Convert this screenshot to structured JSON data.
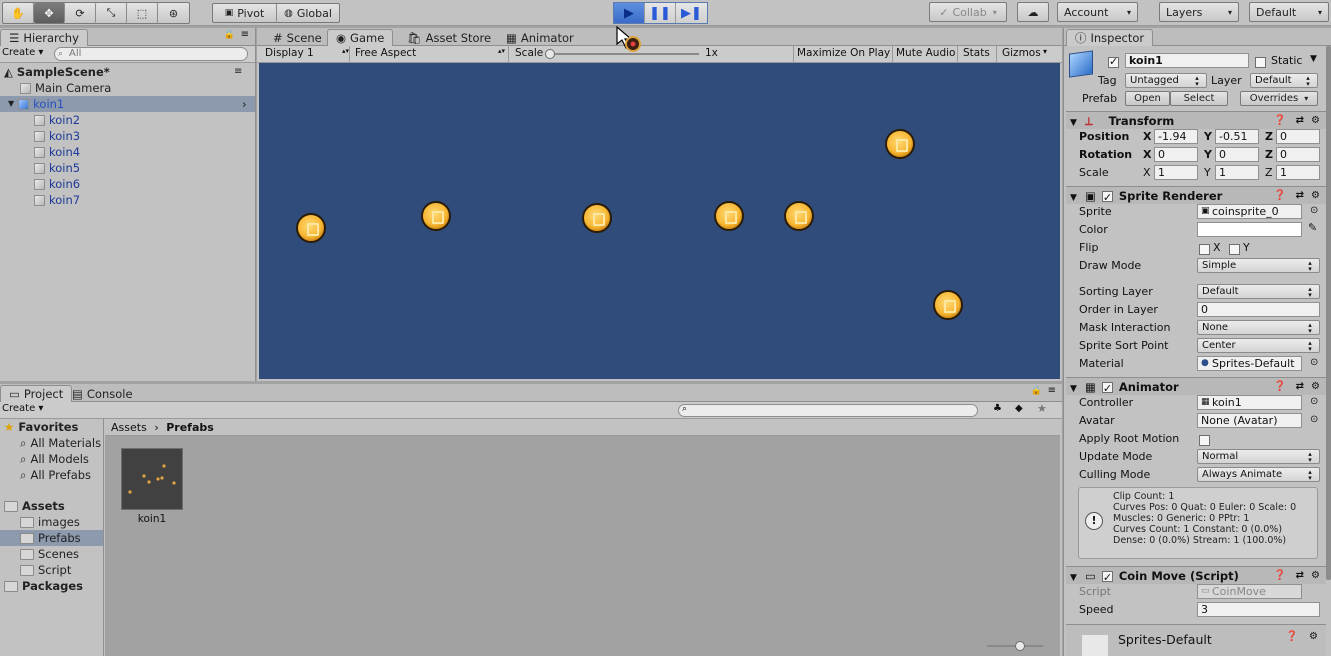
{
  "toolbar": {
    "pivot_label": "Pivot",
    "global_label": "Global",
    "collab_label": "Collab",
    "account_label": "Account",
    "layers_label": "Layers",
    "layout_label": "Default"
  },
  "hierarchy": {
    "tab": "Hierarchy",
    "create_label": "Create",
    "search_placeholder": "All",
    "scene_name": "SampleScene*",
    "items": [
      "Main Camera",
      "koin1",
      "koin2",
      "koin3",
      "koin4",
      "koin5",
      "koin6",
      "koin7"
    ]
  },
  "game_tabs": {
    "scene": "Scene",
    "game": "Game",
    "asset_store": "Asset Store",
    "animator": "Animator"
  },
  "game_bar": {
    "display": "Display 1",
    "aspect": "Free Aspect",
    "scale_label": "Scale",
    "scale_value": "1x",
    "maximize": "Maximize On Play",
    "mute": "Mute Audio",
    "stats": "Stats",
    "gizmos": "Gizmos"
  },
  "project": {
    "tab_project": "Project",
    "tab_console": "Console",
    "create_label": "Create",
    "favorites_label": "Favorites",
    "favorites": [
      "All Materials",
      "All Models",
      "All Prefabs"
    ],
    "assets_label": "Assets",
    "asset_folders": [
      "images",
      "Prefabs",
      "Scenes",
      "Script"
    ],
    "packages_label": "Packages",
    "breadcrumb_root": "Assets",
    "breadcrumb_current": "Prefabs",
    "asset_item": "koin1"
  },
  "inspector": {
    "tab": "Inspector",
    "object_name": "koin1",
    "static_label": "Static",
    "tag_label": "Tag",
    "tag_value": "Untagged",
    "layer_label": "Layer",
    "layer_value": "Default",
    "prefab_label": "Prefab",
    "prefab_open": "Open",
    "prefab_select": "Select",
    "prefab_overrides": "Overrides",
    "transform": {
      "title": "Transform",
      "position_label": "Position",
      "pos_x": "-1.94",
      "pos_y": "-0.51",
      "pos_z": "0",
      "rotation_label": "Rotation",
      "rot_x": "0",
      "rot_y": "0",
      "rot_z": "0",
      "scale_label": "Scale",
      "scale_x": "1",
      "scale_y": "1",
      "scale_z": "1",
      "x": "X",
      "y": "Y",
      "z": "Z"
    },
    "sprite_renderer": {
      "title": "Sprite Renderer",
      "sprite_label": "Sprite",
      "sprite_value": "coinsprite_0",
      "color_label": "Color",
      "flip_label": "Flip",
      "flip_x": "X",
      "flip_y": "Y",
      "draw_mode_label": "Draw Mode",
      "draw_mode_value": "Simple",
      "sorting_layer_label": "Sorting Layer",
      "sorting_layer_value": "Default",
      "order_label": "Order in Layer",
      "order_value": "0",
      "mask_label": "Mask Interaction",
      "mask_value": "None",
      "sort_point_label": "Sprite Sort Point",
      "sort_point_value": "Center",
      "material_label": "Material",
      "material_value": "Sprites-Default"
    },
    "animator": {
      "title": "Animator",
      "controller_label": "Controller",
      "controller_value": "koin1",
      "avatar_label": "Avatar",
      "avatar_value": "None (Avatar)",
      "root_motion_label": "Apply Root Motion",
      "update_mode_label": "Update Mode",
      "update_mode_value": "Normal",
      "culling_label": "Culling Mode",
      "culling_value": "Always Animate",
      "info": [
        "Clip Count: 1",
        "Curves Pos: 0 Quat: 0 Euler: 0 Scale: 0",
        "Muscles: 0 Generic: 0 PPtr: 1",
        "Curves Count: 1 Constant: 0 (0.0%)",
        "Dense: 0 (0.0%) Stream: 1 (100.0%)"
      ]
    },
    "coin_move": {
      "title": "Coin Move (Script)",
      "script_label": "Script",
      "script_value": "CoinMove",
      "speed_label": "Speed",
      "speed_value": "3"
    },
    "material_footer": "Sprites-Default"
  },
  "colors": {
    "game_bg": "#2f4c7b",
    "coin": "#f7b733",
    "selection": "#8d9aad",
    "play_active": "#3a6cc8"
  }
}
